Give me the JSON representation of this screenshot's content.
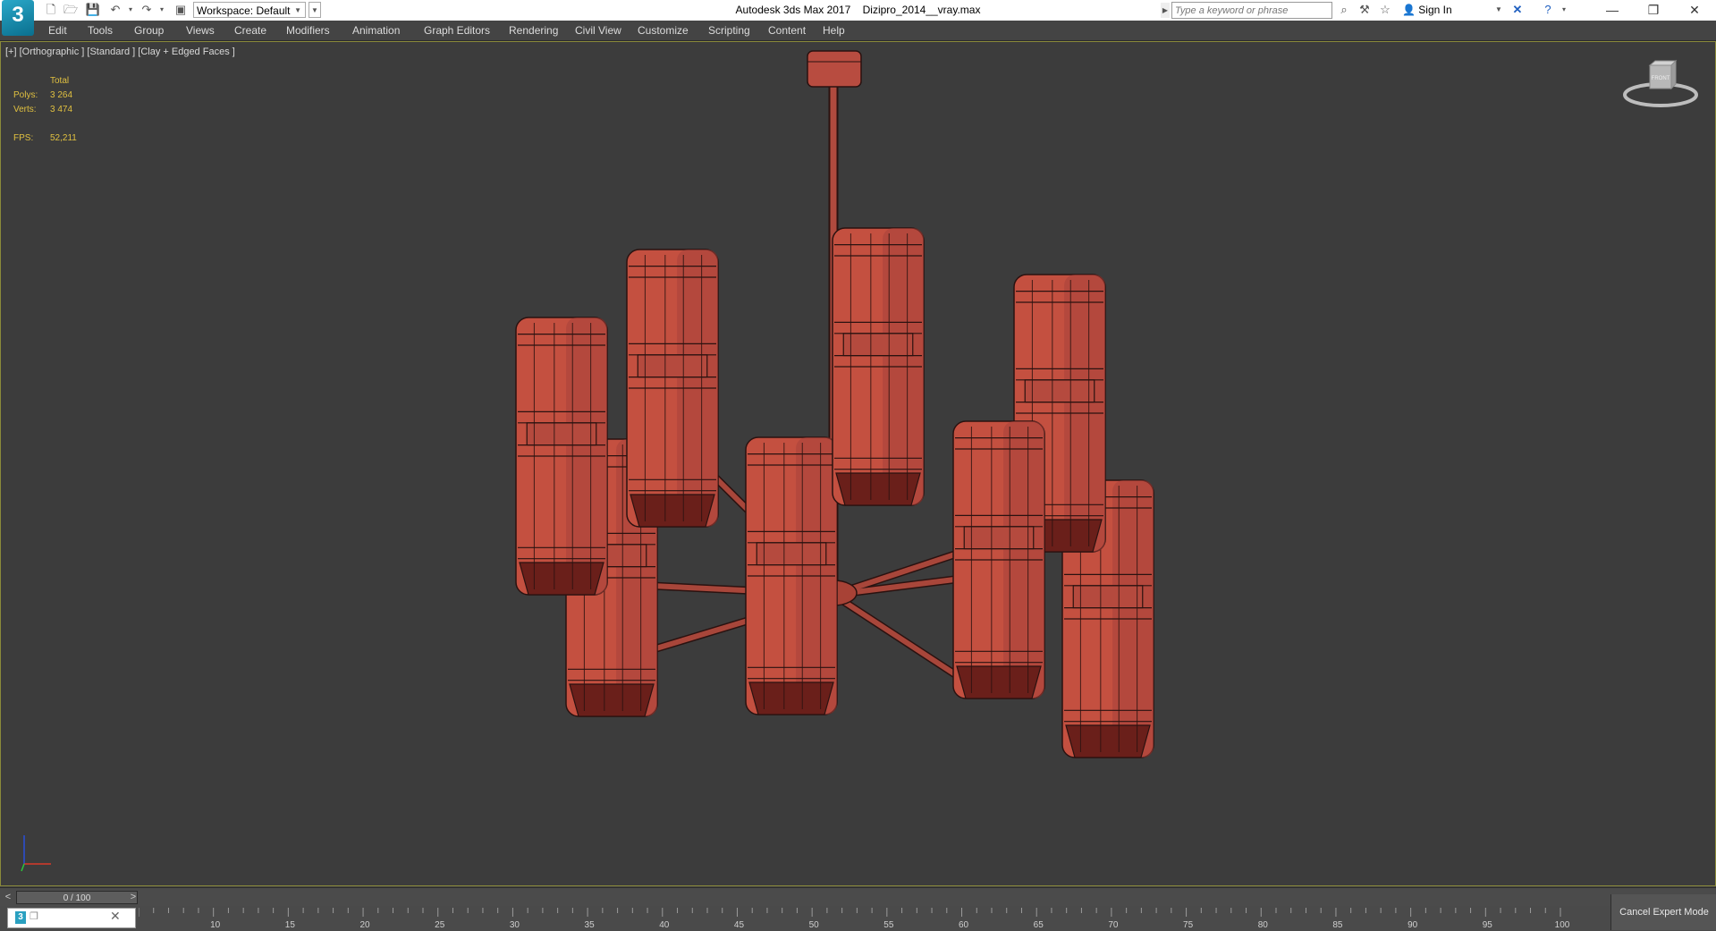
{
  "titlebar": {
    "app": "Autodesk 3ds Max 2017",
    "file": "Dizipro_2014__vray.max",
    "workspace": "Workspace: Default",
    "search_placeholder": "Type a keyword or phrase",
    "sign_in": "Sign In"
  },
  "menu": {
    "items": [
      "Edit",
      "Tools",
      "Group",
      "Views",
      "Create",
      "Modifiers",
      "Animation",
      "Graph Editors",
      "Rendering",
      "Civil View",
      "Customize",
      "Scripting",
      "Content",
      "Help"
    ]
  },
  "viewport": {
    "label": "[+] [Orthographic ] [Standard ] [Clay + Edged Faces ]",
    "stats": {
      "total_label": "Total",
      "polys_label": "Polys:",
      "polys": "3 264",
      "verts_label": "Verts:",
      "verts": "3 474",
      "fps_label": "FPS:",
      "fps": "52,211"
    },
    "model_color": "#c45040",
    "viewcube_label": "FRONT"
  },
  "timeline": {
    "frame": "0 / 100",
    "prev": "<",
    "next": ">",
    "ticks": [
      "10",
      "15",
      "20",
      "25",
      "30",
      "35",
      "40",
      "45",
      "50",
      "55",
      "60",
      "65",
      "70",
      "75",
      "80",
      "85",
      "90",
      "95",
      "100"
    ]
  },
  "status": {
    "cancel_expert": "Cancel Expert Mode",
    "listener_icon": "3"
  }
}
